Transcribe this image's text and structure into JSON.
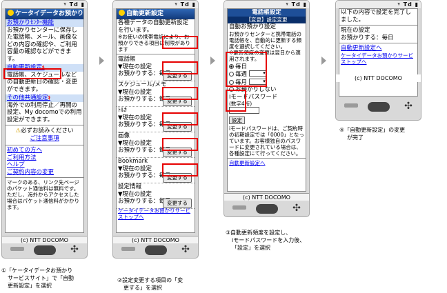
{
  "status_icons": "ᵞ Td ▮",
  "copyright": "(c) NTT DOCOMO",
  "screen1": {
    "title": "ケータイデータお預かり",
    "sec1": "お預かりｾﾝﾀｰ機能",
    "sec1_text": "お預かりセンターに保存した電話帳、メール、画像などの内容の確認や、ご利用容量の確認などができます。",
    "sec2": "自動更新設定",
    "sec2_text": "電話帳、スケジュールなどの自動更新日の確認・変更ができます。",
    "sec3": "その他共通設定",
    "sec3_text": "海外での利用停止／再開の設定、My docomoでの利用設定ができます。",
    "notice": "必ずお読みください",
    "notice_link": "ご注意事項",
    "link1": "初めての方へ",
    "link2": "ご利用方法",
    "link3": "ヘルプ",
    "link4": "ご契約内容の変更",
    "bottom_text": "マークのある、リンク先ページのパケット通信料は無料です。ただし、海外からアクセスした場合はパケット通信料がかかります。"
  },
  "screen2": {
    "title": "自動更新設定",
    "intro": "各種データの自動更新設定を行います。",
    "note": "※お使いの携帯電話により、お預かりできる項目に制限があります",
    "items": [
      {
        "name": "電話帳",
        "current": "▼現在の設定",
        "value": "お預かりする：毎日",
        "button": "変更する"
      },
      {
        "name": "スケジュール/メモ",
        "current": "▼現在の設定",
        "value": "お預かりする：毎日",
        "button": "変更する"
      },
      {
        "name": "ﾄﾙｶ",
        "current": "▼現在の設定",
        "value": "お預かりする：毎日",
        "button": "変更する"
      },
      {
        "name": "画像",
        "current": "▼現在の設定",
        "value": "お預かりする：毎日",
        "button": "変更する"
      },
      {
        "name": "Bookmark",
        "current": "▼現在の設定",
        "value": "お預かりする：毎日",
        "button": "変更する"
      },
      {
        "name": "設定情報",
        "current": "▼現在の設定",
        "value": "お預かりする：毎日",
        "button": "変更する"
      }
    ],
    "back_link": "ケータイデータお預かりサービストップへ"
  },
  "screen3": {
    "title": "電話帳設定",
    "subtitle": "【変更】設定変更",
    "heading": "自動お預かり設定",
    "text": "お預かりセンターと携帯電話の電話帳を、自動的に更新する頻度を選択してください。",
    "note": "※更新頻度の変更は翌日から適用されます。",
    "options": [
      "毎日",
      "毎週",
      "毎月",
      "お預かりしない"
    ],
    "pw_label": "iモードパスワード",
    "pw_hint": "(数字4桁)",
    "submit": "設定",
    "pw_note": "iモードパスワードは、ご契約時の初期設定では「0000」となっています。お客様独自のパスワードに変更されている場合は、各種設定にて行ってください。",
    "back_link": "自動更新設定へ"
  },
  "screen4": {
    "text": "以下の内容で設定を完了しました。",
    "current_label": "現在の設定",
    "current_value": "お預かりする：毎日",
    "link1": "自動更新設定へ",
    "link2": "ケータイデータお預かりサービストップへ"
  },
  "captions": {
    "c1": [
      "①「ケータイデータお預かり",
      "サービスサイト」で「自動",
      "更新設定」を選択"
    ],
    "c2": [
      "②設定変更する項目の「変",
      "更する」を選択"
    ],
    "c3": [
      "③自動更新頻度を設定し、",
      "iモードパスワードを入力後、",
      "「設定」を選択"
    ],
    "c4": [
      "④「自動更新設定」の変更",
      "が完了"
    ]
  },
  "colors": {
    "accent_red": "#e60000",
    "title_blue": "#1e4f98",
    "link_blue": "#0000ee"
  }
}
